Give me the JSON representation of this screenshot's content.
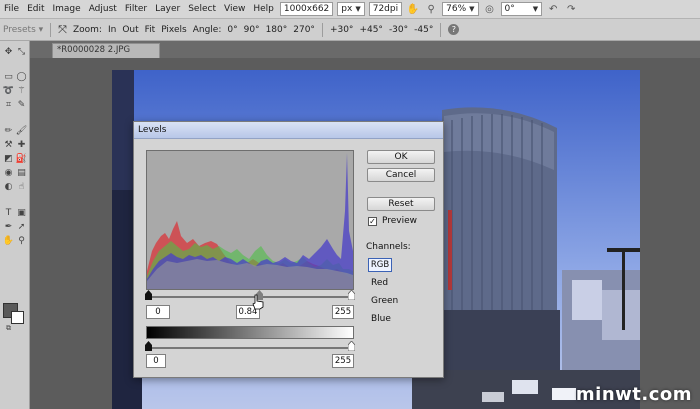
{
  "menu": {
    "items": [
      "File",
      "Edit",
      "Image",
      "Adjust",
      "Filter",
      "Layer",
      "Select",
      "View",
      "Help"
    ],
    "image_size": "1000x662",
    "unit": "px",
    "resolution": "72dpi",
    "zoom": "76%",
    "rotation": "0°"
  },
  "toolbar": {
    "presets": "Presets",
    "zoom_label": "Zoom:",
    "zoom_in": "In",
    "zoom_out": "Out",
    "fit": "Fit",
    "pixels": "Pixels",
    "angle_label": "Angle:",
    "angles": [
      "0°",
      "90°",
      "180°",
      "270°"
    ],
    "rotate_steps": [
      "+30°",
      "+45°",
      "-30°",
      "-45°"
    ]
  },
  "document": {
    "tab_title": "*R0000028 2.JPG"
  },
  "levels_dialog": {
    "title": "Levels",
    "input_black": "0",
    "input_gamma": "0.84",
    "input_white": "255",
    "output_black": "0",
    "output_white": "255",
    "buttons": {
      "ok": "OK",
      "cancel": "Cancel",
      "reset": "Reset"
    },
    "preview_label": "Preview",
    "preview_checked": true,
    "channels_label": "Channels:",
    "channels": [
      "RGB",
      "Red",
      "Green",
      "Blue"
    ],
    "selected_channel": "RGB"
  },
  "watermark": "minwt.com",
  "colors": {
    "hist_red": "#d9363b",
    "hist_green": "#4fbf46",
    "hist_blue": "#4a3fc8",
    "hist_bg": "#a9a9a9"
  }
}
